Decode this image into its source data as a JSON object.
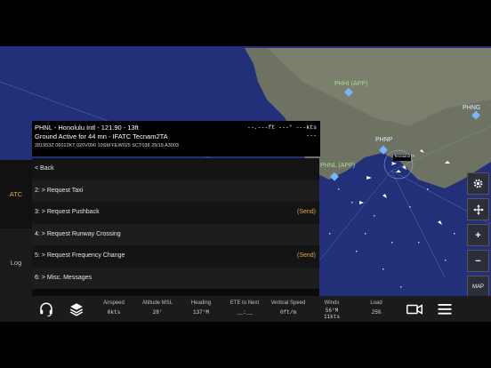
{
  "info": {
    "airport_line": "PHNL - Honolulu Intl - 121.90 - 13ft",
    "status_line": "Ground Active for 44 mn - IFATC Tecnam2TA",
    "metar_line": "281953Z 06012KT 020V090 10SM FEW025 SCT038 29/19 A3003",
    "distance_readout": "--.---ft  ---° ---kts",
    "dash_readout": "---"
  },
  "rail": {
    "atc_label": "ATC",
    "log_label": "Log"
  },
  "menu": {
    "items": [
      {
        "label": "< Back",
        "send": ""
      },
      {
        "label": "2: > Request Taxi",
        "send": ""
      },
      {
        "label": "3: > Request Pushback",
        "send": "(Send)"
      },
      {
        "label": "4: > Request Runway Crossing",
        "send": ""
      },
      {
        "label": "5: > Request Frequency Change",
        "send": "(Send)"
      },
      {
        "label": "6: > Misc. Messages",
        "send": ""
      }
    ]
  },
  "map": {
    "labels": {
      "phhi": "PHHI (APP)",
      "phng": "PHNG",
      "phnp": "PHNP",
      "phnl": "PHNL (APP)"
    },
    "callout_text": "Tecnam2TA"
  },
  "controls": {
    "map_label": "MAP"
  },
  "metrics": [
    {
      "label": "Airspeed",
      "value": "0kts"
    },
    {
      "label": "Altitude MSL",
      "value": "28'"
    },
    {
      "label": "Heading",
      "value": "137°M"
    },
    {
      "label": "ETE to Next",
      "value": "__:__"
    },
    {
      "label": "Vertical Speed",
      "value": "0ft/m"
    },
    {
      "label": "Winds",
      "value": "56°M"
    },
    {
      "label": "Load",
      "value": "25%"
    }
  ],
  "winds_speed": "11kts",
  "icons": [
    "headset-icon",
    "layers-icon",
    "camera-icon",
    "menu-icon",
    "gear-icon",
    "move-icon",
    "zoom-in-icon",
    "zoom-out-icon"
  ]
}
